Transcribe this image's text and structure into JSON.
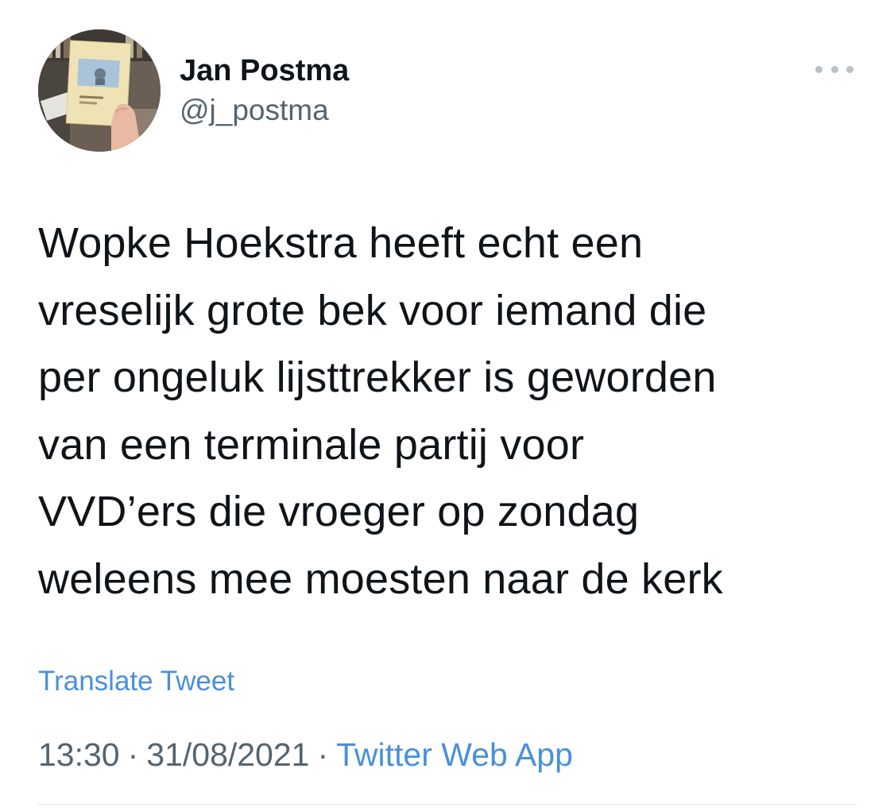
{
  "author": {
    "display_name": "Jan Postma",
    "handle": "@j_postma",
    "avatar_book_text": "Jan Postma\nIs dit alles?"
  },
  "more_icon": "more-horizontal-icon",
  "tweet": {
    "text": "Wopke Hoekstra heeft echt een\nvreselijk grote bek voor iemand die\nper ongeluk lijsttrekker is geworden\nvan een terminale partij voor\nVVD’ers die vroeger op zondag\nweleens mee moesten naar de kerk",
    "translate_label": "Translate Tweet",
    "time": "13:30",
    "separator": "·",
    "date": "31/08/2021",
    "source": "Twitter Web App"
  },
  "colors": {
    "link": "#4a90d9",
    "secondary_text": "#536471",
    "primary_text": "#0f1419"
  }
}
